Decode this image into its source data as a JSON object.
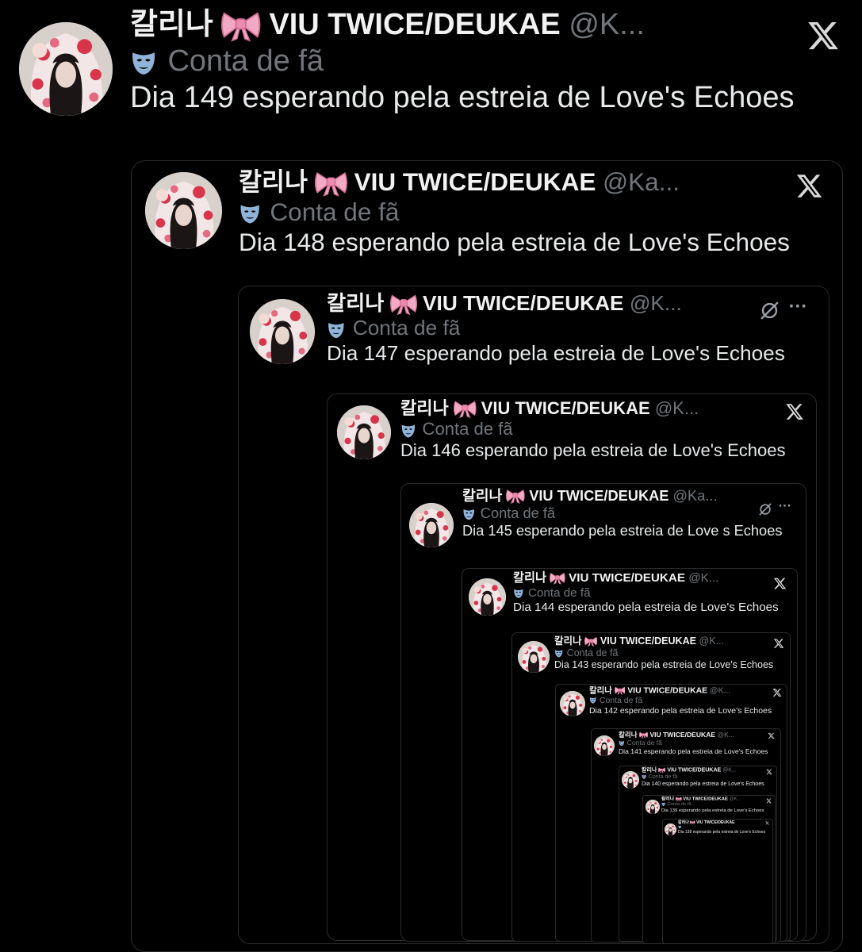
{
  "tweets": [
    {
      "display_name": "칼리나",
      "account": "VIU TWICE/DEUKAE",
      "handle": "@K...",
      "label": "Conta de fã",
      "text": "Dia 149 esperando pela estreia de Love's Echoes",
      "icon": "x-logo-icon"
    },
    {
      "display_name": "칼리나",
      "account": "VIU TWICE/DEUKAE",
      "handle": "@Ka...",
      "label": "Conta de fã",
      "text": "Dia 148 esperando pela estreia de Love's Echoes",
      "icon": "x-logo-icon"
    },
    {
      "display_name": "칼리나",
      "account": "VIU TWICE/DEUKAE",
      "handle": "@K...",
      "label": "Conta de fã",
      "text": "Dia 147 esperando pela estreia de Love's Echoes",
      "icon": "grok-icon",
      "more": "···"
    },
    {
      "display_name": "칼리나",
      "account": "VIU TWICE/DEUKAE",
      "handle": "@K...",
      "label": "Conta de fã",
      "text": "Dia 146 esperando pela estreia de Love's Echoes",
      "icon": "x-logo-icon"
    },
    {
      "display_name": "칼리나",
      "account": "VIU TWICE/DEUKAE",
      "handle": "@Ka...",
      "label": "Conta de fã",
      "text": "Dia 145 esperando pela estreia de Love s Echoes",
      "icon": "grok-icon",
      "more": "···"
    },
    {
      "display_name": "칼리나",
      "account": "VIU TWICE/DEUKAE",
      "handle": "@K...",
      "label": "Conta de fã",
      "text": "Dia 144 esperando pela estreia de Love's Echoes",
      "icon": "x-logo-icon"
    },
    {
      "display_name": "칼리나",
      "account": "VIU TWICE/DEUKAE",
      "handle": "@K...",
      "label": "Conta de fã",
      "text": "Dia 143 esperando pela estreia de Love's Echoes",
      "icon": "x-logo-icon"
    },
    {
      "display_name": "칼리나",
      "account": "VIU TWICE/DEUKAE",
      "handle": "@K...",
      "label": "Conta de fã",
      "text": "Dia 142 esperando pela estreia de Love's Echoes",
      "icon": "x-logo-icon"
    },
    {
      "display_name": "칼리나",
      "account": "VIU TWICE/DEUKAE",
      "handle": "@K...",
      "label": "Conta de fã",
      "text": "Dia 141 esperando pela estreia de Love's Echoes",
      "icon": "x-logo-icon"
    },
    {
      "display_name": "칼리나",
      "account": "VIU TWICE/DEUKAE",
      "handle": "@K...",
      "label": "Conta de fã",
      "text": "Dia 140 esperando pela estreia de Love's Echoes",
      "icon": "x-logo-icon"
    },
    {
      "display_name": "칼리나",
      "account": "VIU TWICE/DEUKAE",
      "handle": "@K...",
      "label": "Conta de fã",
      "text": "Dia 139 esperando pela estreia de Love's Echoes",
      "icon": "x-logo-icon"
    },
    {
      "display_name": "칼리나",
      "account": "VIU TWICE/DEUKAE",
      "handle": "",
      "label": "",
      "text": "Dia 138 esperando pela estreia de Love's Echoes",
      "icon": "x-logo-icon"
    }
  ],
  "colors": {
    "background": "#000000",
    "name": "#f2f2f2",
    "muted": "#71767b",
    "text": "#e7e9ea",
    "card_border": "#2b2b2b",
    "bow_pink": "#f2a9c4",
    "mask_blue": "#8fb3d9"
  }
}
